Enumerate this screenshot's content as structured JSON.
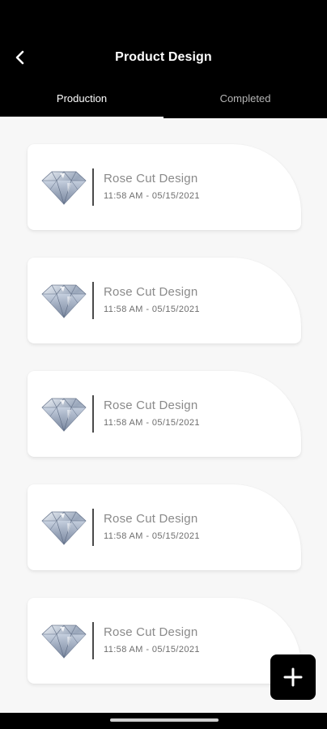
{
  "header": {
    "title": "Product Design",
    "back_icon": "chevron-left-icon"
  },
  "tabs": [
    {
      "label": "Production",
      "active": true
    },
    {
      "label": "Completed",
      "active": false
    }
  ],
  "designs": [
    {
      "name": "Rose Cut Design",
      "timestamp": "11:58 AM - 05/15/2021",
      "icon": "diamond-icon"
    },
    {
      "name": "Rose Cut Design",
      "timestamp": "11:58 AM - 05/15/2021",
      "icon": "diamond-icon"
    },
    {
      "name": "Rose Cut Design",
      "timestamp": "11:58 AM - 05/15/2021",
      "icon": "diamond-icon"
    },
    {
      "name": "Rose Cut Design",
      "timestamp": "11:58 AM - 05/15/2021",
      "icon": "diamond-icon"
    },
    {
      "name": "Rose Cut Design",
      "timestamp": "11:58 AM - 05/15/2021",
      "icon": "diamond-icon"
    }
  ],
  "fab": {
    "icon": "plus-icon"
  },
  "colors": {
    "header_bg": "#000000",
    "page_bg": "#f7f7f7",
    "card_bg": "#ffffff",
    "name_text": "#8a8a8a"
  }
}
